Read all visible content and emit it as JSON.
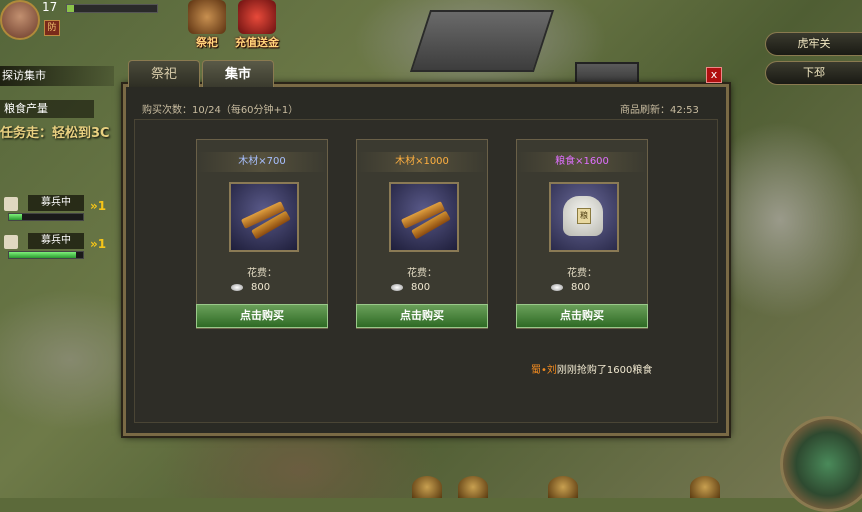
{
  "player": {
    "level": "17",
    "vip": "防"
  },
  "top_icons": [
    {
      "label": "祭祀"
    },
    {
      "label": "充值送金"
    }
  ],
  "left_panel": {
    "quest": "探访集市",
    "production": "粮食产量",
    "quest_text": "任务走：轻松到3C",
    "recruits": [
      {
        "label": "募兵中",
        "progress": 0.18,
        "arrow": "1"
      },
      {
        "label": "募兵中",
        "progress": 0.9,
        "arrow": "1"
      }
    ]
  },
  "right_buttons": [
    "虎牢关",
    "下邳"
  ],
  "dialog": {
    "tabs": [
      {
        "label": "祭祀",
        "active": false
      },
      {
        "label": "集市",
        "active": true
      }
    ],
    "close": "x",
    "purchase_count": "购买次数：10/24（每60分钟+1）",
    "refresh": "商品刷新：42:53",
    "items": [
      {
        "name": "木材×700",
        "name_color": "#a8c0ff",
        "icon": "wood-icon",
        "cost_label": "花费：",
        "cost": "800",
        "buy": "点击购买"
      },
      {
        "name": "木材×1000",
        "name_color": "#ffb040",
        "icon": "wood-icon",
        "cost_label": "花费：",
        "cost": "800",
        "buy": "点击购买"
      },
      {
        "name": "粮食×1600",
        "name_color": "#e070ff",
        "icon": "grain-sack-icon",
        "cost_label": "花费：",
        "cost": "800",
        "buy": "点击购买"
      }
    ],
    "news": {
      "who": "蜀•刘",
      "text": "刚刚抢购了1600粮食"
    }
  }
}
